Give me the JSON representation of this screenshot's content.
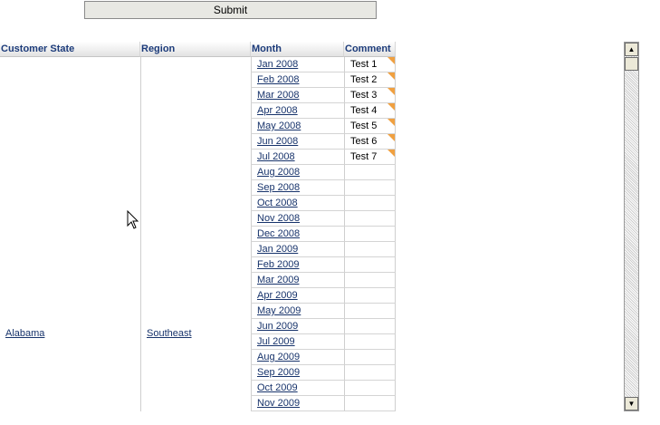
{
  "submit_label": "Submit",
  "headers": {
    "customer_state": "Customer State",
    "region": "Region",
    "month": "Month",
    "comment": "Comment"
  },
  "row_group": {
    "customer_state": "Alabama",
    "region": "Southeast"
  },
  "rows": [
    {
      "month": "Jan 2008",
      "comment": "Test 1"
    },
    {
      "month": "Feb 2008",
      "comment": "Test 2"
    },
    {
      "month": "Mar 2008",
      "comment": "Test 3"
    },
    {
      "month": "Apr 2008",
      "comment": "Test 4"
    },
    {
      "month": "May 2008",
      "comment": "Test 5"
    },
    {
      "month": "Jun 2008",
      "comment": "Test 6"
    },
    {
      "month": "Jul 2008",
      "comment": "Test 7"
    },
    {
      "month": "Aug 2008",
      "comment": ""
    },
    {
      "month": "Sep 2008",
      "comment": ""
    },
    {
      "month": "Oct 2008",
      "comment": ""
    },
    {
      "month": "Nov 2008",
      "comment": ""
    },
    {
      "month": "Dec 2008",
      "comment": ""
    },
    {
      "month": "Jan 2009",
      "comment": ""
    },
    {
      "month": "Feb 2009",
      "comment": ""
    },
    {
      "month": "Mar 2009",
      "comment": ""
    },
    {
      "month": "Apr 2009",
      "comment": ""
    },
    {
      "month": "May 2009",
      "comment": ""
    },
    {
      "month": "Jun 2009",
      "comment": ""
    },
    {
      "month": "Jul 2009",
      "comment": ""
    },
    {
      "month": "Aug 2009",
      "comment": ""
    },
    {
      "month": "Sep 2009",
      "comment": ""
    },
    {
      "month": "Oct 2009",
      "comment": ""
    },
    {
      "month": "Nov 2009",
      "comment": ""
    }
  ],
  "scrollbar": {
    "up_icon": "arrow-up-icon",
    "down_icon": "arrow-down-icon"
  },
  "colors": {
    "header_text": "#1c3b7a",
    "link": "#17336b",
    "comment_flag": "#f0a040"
  }
}
